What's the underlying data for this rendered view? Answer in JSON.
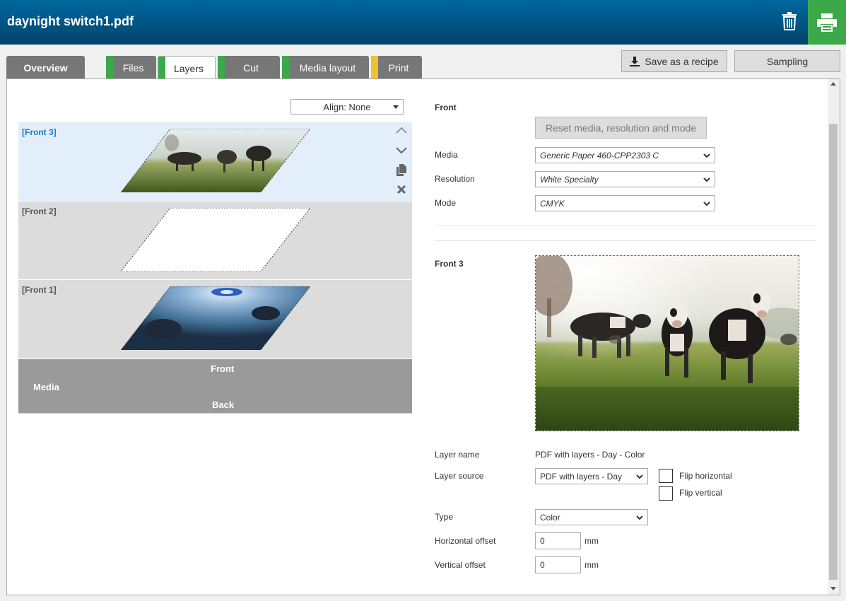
{
  "header": {
    "title": "daynight switch1.pdf"
  },
  "tabs": [
    {
      "label": "Overview",
      "status_color": ""
    },
    {
      "label": "Files",
      "status_color": "#3ba84a"
    },
    {
      "label": "Layers",
      "status_color": "#3ba84a"
    },
    {
      "label": "Cut",
      "status_color": "#3ba84a"
    },
    {
      "label": "Media layout",
      "status_color": "#3ba84a"
    },
    {
      "label": "Print",
      "status_color": "#f2c12e"
    }
  ],
  "toolbar": {
    "save_recipe_label": "Save as a recipe",
    "sampling_label": "Sampling"
  },
  "align": {
    "value": "Align: None"
  },
  "layers": [
    {
      "name": "[Front 3]",
      "selected": true
    },
    {
      "name": "[Front 2]",
      "selected": false
    },
    {
      "name": "[Front 1]",
      "selected": false
    }
  ],
  "media_block": {
    "front": "Front",
    "media": "Media",
    "back": "Back"
  },
  "front_section": {
    "heading": "Front",
    "reset_label": "Reset media, resolution and mode",
    "media_label": "Media",
    "media_value": "Generic Paper 460-CPP2303 C",
    "resolution_label": "Resolution",
    "resolution_value": "White Specialty",
    "mode_label": "Mode",
    "mode_value": "CMYK"
  },
  "layer_section": {
    "heading": "Front 3",
    "layer_name_label": "Layer name",
    "layer_name_value": "PDF with layers - Day - Color",
    "layer_source_label": "Layer source",
    "layer_source_value": "PDF with layers - Day",
    "flip_horizontal_label": "Flip horizontal",
    "flip_vertical_label": "Flip vertical",
    "type_label": "Type",
    "type_value": "Color",
    "h_offset_label": "Horizontal offset",
    "h_offset_value": "0",
    "v_offset_label": "Vertical offset",
    "v_offset_value": "0",
    "unit": "mm"
  }
}
